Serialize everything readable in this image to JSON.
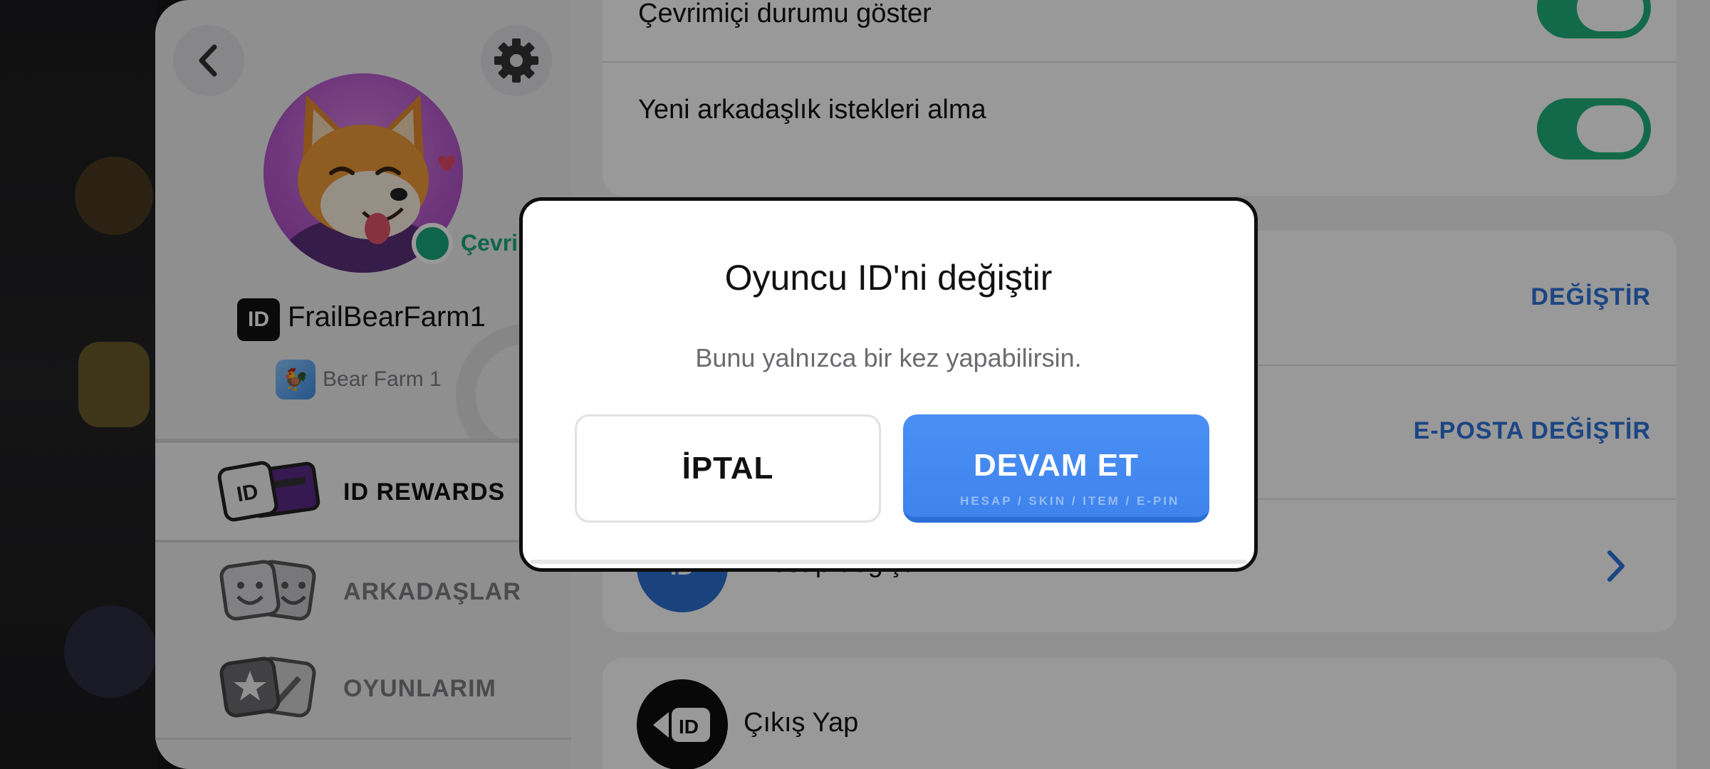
{
  "profile": {
    "online_status": "Çevri",
    "username": "FrailBearFarm1",
    "id_badge": "ID",
    "game_name": "Bear Farm 1"
  },
  "menu": [
    {
      "label": "ID REWARDS",
      "icon": "id-card-icon"
    },
    {
      "label": "ARKADAŞLAR",
      "icon": "friends-icon"
    },
    {
      "label": "OYUNLARIM",
      "icon": "my-games-icon"
    }
  ],
  "settings": {
    "online_status_row": "Çevrimiçi durumu göster",
    "friend_requests_row": "Yeni arkadaşlık istekleri alma",
    "change_id_link": "DEĞİŞTİR",
    "change_email_link": "E-POSTA DEĞİŞTİR",
    "switch_account_row": "Hesap değiştir",
    "logout_row": "Çıkış Yap",
    "id_icon_text": "ID"
  },
  "dialog": {
    "title": "Oyuncu ID'ni değiştir",
    "subtitle": "Bunu yalnızca bir kez yapabilirsin.",
    "cancel_label": "İPTAL",
    "continue_label": "DEVAM ET",
    "watermark": "HESAP / SKIN / ITEM / E-PIN"
  },
  "colors": {
    "accent_blue": "#4a8ff3",
    "toggle_green": "#1fb17e",
    "link_blue": "#2f73d9",
    "online_green": "#19a97a"
  }
}
